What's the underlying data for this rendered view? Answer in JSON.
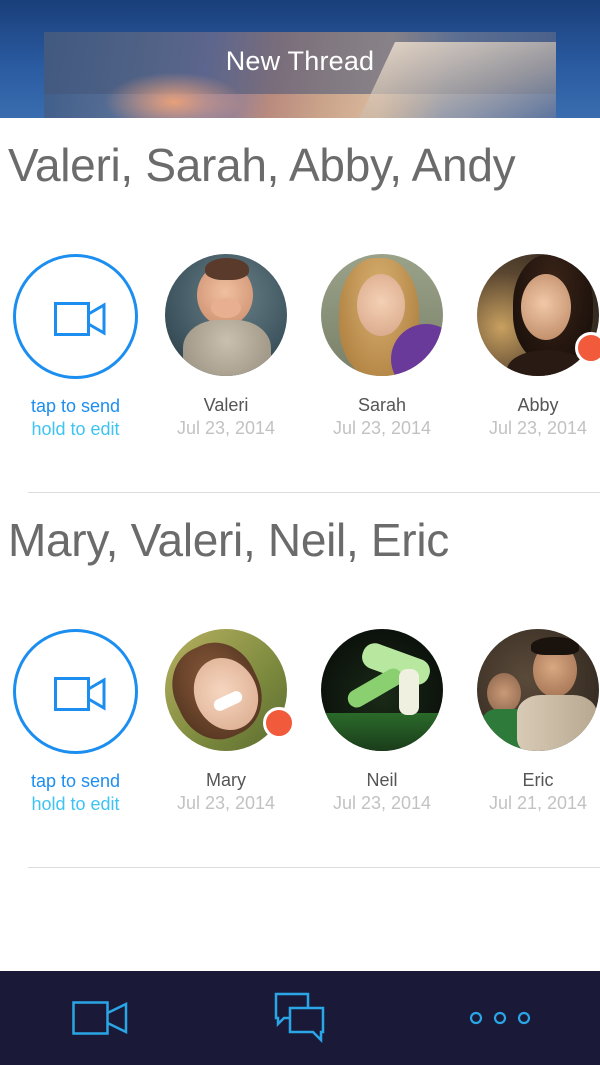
{
  "header": {
    "title": "New Thread"
  },
  "threads": [
    {
      "title": "Valeri, Sarah, Abby, Andy",
      "send": {
        "line1": "tap to send",
        "line2": "hold to edit"
      },
      "members": [
        {
          "name": "Valeri",
          "date": "Jul 23, 2014",
          "unread": false
        },
        {
          "name": "Sarah",
          "date": "Jul 23, 2014",
          "unread": false
        },
        {
          "name": "Abby",
          "date": "Jul 23, 2014",
          "unread": true
        }
      ]
    },
    {
      "title": "Mary, Valeri, Neil, Eric",
      "send": {
        "line1": "tap to send",
        "line2": "hold to edit"
      },
      "members": [
        {
          "name": "Mary",
          "date": "Jul 23, 2014",
          "unread": true
        },
        {
          "name": "Neil",
          "date": "Jul 23, 2014",
          "unread": false
        },
        {
          "name": "Eric",
          "date": "Jul 21, 2014",
          "unread": false
        }
      ]
    }
  ],
  "tabbar": {
    "items": [
      {
        "icon": "video-camera-icon"
      },
      {
        "icon": "chat-bubbles-icon"
      },
      {
        "icon": "more-dots-icon"
      }
    ]
  },
  "colors": {
    "accent": "#1c8ef0",
    "accent_light": "#3ec3f2",
    "unread_dot": "#f15a3a",
    "tabbar_bg": "#1a1a38",
    "tab_icon": "#2aa6e6"
  }
}
